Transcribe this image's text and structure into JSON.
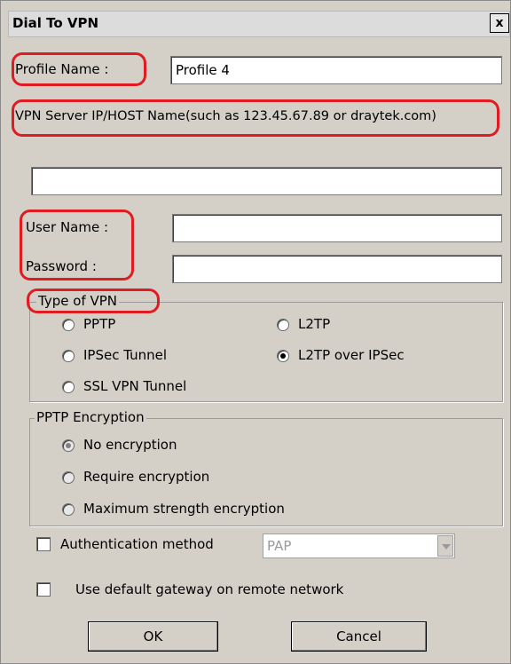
{
  "window": {
    "title": "Dial To VPN",
    "close_glyph": "x"
  },
  "profile": {
    "label": "Profile Name :",
    "value": "Profile 4"
  },
  "server": {
    "label": "VPN Server IP/HOST Name(such as 123.45.67.89 or draytek.com)",
    "value": ""
  },
  "credentials": {
    "username_label": "User Name :",
    "username_value": "",
    "password_label": "Password :",
    "password_value": ""
  },
  "vpn_type": {
    "legend": "Type of VPN",
    "options": [
      "PPTP",
      "L2TP",
      "IPSec Tunnel",
      "L2TP over IPSec",
      "SSL VPN Tunnel"
    ],
    "selected": "L2TP over IPSec"
  },
  "pptp_encryption": {
    "legend": "PPTP Encryption",
    "options": [
      "No encryption",
      "Require encryption",
      "Maximum strength encryption"
    ],
    "selected": "No encryption",
    "disabled": true
  },
  "auth": {
    "label": "Authentication method",
    "checked": false,
    "select_value": "PAP",
    "select_disabled": true
  },
  "gateway": {
    "label": "Use default gateway on remote network",
    "checked": false
  },
  "buttons": {
    "ok": "OK",
    "cancel": "Cancel"
  },
  "colors": {
    "highlight": "#e11b22",
    "dialog_bg": "#d4d0c8"
  }
}
